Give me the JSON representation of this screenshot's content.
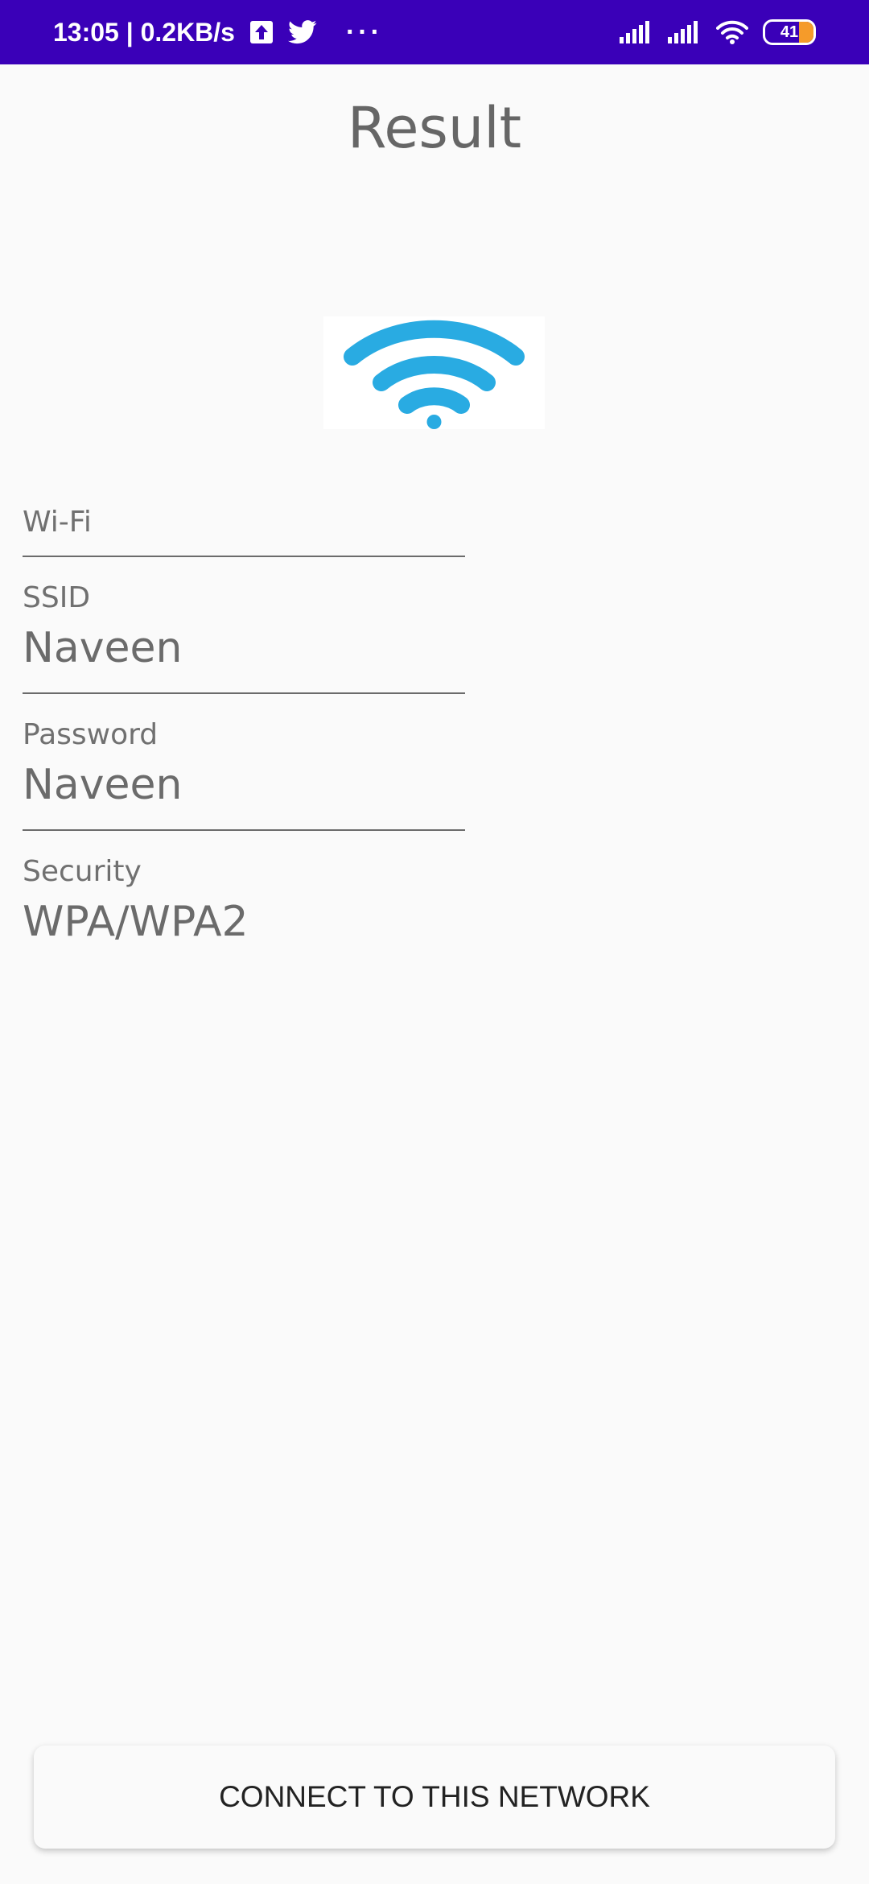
{
  "status_bar": {
    "time_speed": "13:05 | 0.2KB/s",
    "overflow": "···",
    "battery_level": "41",
    "icons": [
      "upload-icon",
      "twitter-icon",
      "signal-icon",
      "signal-icon",
      "wifi-icon",
      "battery-icon"
    ]
  },
  "screen": {
    "title": "Result",
    "image_icon": "wifi-icon",
    "accent_color": "#29abe2"
  },
  "fields": {
    "type_label": "Wi-Fi",
    "ssid_label": "SSID",
    "ssid_value": "Naveen",
    "password_label": "Password",
    "password_value": "Naveen",
    "security_label": "Security",
    "security_value": "WPA/WPA2"
  },
  "actions": {
    "connect_label": "CONNECT TO THIS NETWORK"
  }
}
